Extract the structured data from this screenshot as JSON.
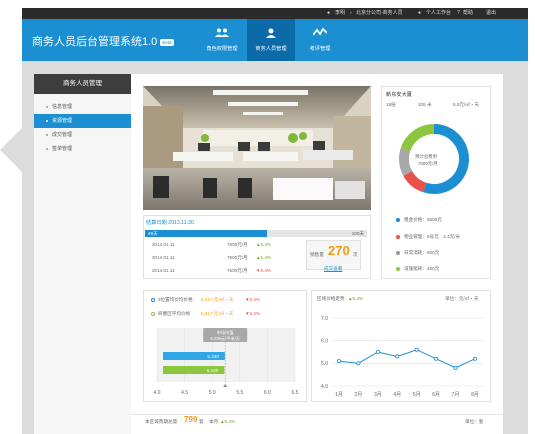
{
  "topbar": {
    "user": "李明",
    "org": "北京分公司-商务人员",
    "workbench": "个人工作台",
    "help": "帮助",
    "logout": "退出"
  },
  "header": {
    "title": "商务人员后台管理系统1.0",
    "beta": "Beta",
    "nav": [
      {
        "label": "角色权限管理",
        "icon": "users-icon"
      },
      {
        "label": "商务人员管理",
        "icon": "user-icon"
      },
      {
        "label": "考评管理",
        "icon": "chart-line-icon"
      }
    ],
    "active_nav": 1
  },
  "sidebar": {
    "title": "商务人员管理",
    "items": [
      "信息管理",
      "资源管理",
      "成交管理",
      "签单管理"
    ],
    "active_index": 1
  },
  "property": {
    "name": "新东安大厦",
    "stats": [
      "18层",
      "105 米",
      "6.5元/㎡・天"
    ],
    "donut_center_line1": "预计总费用",
    "donut_center_line2": "7000元/月",
    "fees": [
      {
        "label": "租金价格：5500元",
        "color": "#1b8fd2"
      },
      {
        "label": "物业管理：6号元　2.4元/米",
        "color": "#e8524a"
      },
      {
        "label": "日常消耗：600元",
        "color": "#999999"
      },
      {
        "label": "设施能耗：450元",
        "color": "#8cc63f"
      }
    ]
  },
  "donut_data": [
    {
      "value": 55,
      "color": "#1b8fd2"
    },
    {
      "value": 12,
      "color": "#e8524a"
    },
    {
      "value": 13,
      "color": "#a8a8a8"
    },
    {
      "value": 20,
      "color": "#8cc63f"
    }
  ],
  "countdown": {
    "title": "结算日期 2013.11.30",
    "elapsed": "49天",
    "total": "100天",
    "progress": 0.55,
    "rows": [
      {
        "date": "2014.01.11",
        "price": "7600元/月",
        "change": "▲5.4%",
        "up": true
      },
      {
        "date": "2014.01.11",
        "price": "7600元/月",
        "change": "▲5.4%",
        "up": true
      },
      {
        "date": "2014.01.11",
        "price": "7600元/月",
        "change": "▼5.4%",
        "up": false
      }
    ],
    "sold_label": "销售量",
    "sold_value": "270",
    "sold_unit": "次",
    "sold_link": "成交查看"
  },
  "compare": {
    "legend": [
      {
        "label": "3位置均价均价格",
        "value": "5.417 元/㎡・天",
        "change": "▼5.4%",
        "color": "#1b8fd2"
      },
      {
        "label": "商圈区平均价格",
        "value": "5.417 元/㎡・天",
        "change": "▼5.4%",
        "color": "#8cc63f"
      }
    ],
    "tooltip1": "市场均值",
    "tooltip2": "5.235元/平米/天",
    "bar_blue_label": "5.230",
    "bar_green_label": "5.220"
  },
  "trend": {
    "title": "区域价格走势",
    "change": "▲5.4%",
    "unit": "单位：元/㎡・天",
    "y_ticks": [
      "7.0",
      "6.0",
      "5.0",
      "4.0"
    ],
    "months": [
      "1月",
      "2月",
      "3月",
      "4月",
      "5月",
      "6月",
      "7月",
      "8月"
    ]
  },
  "chart_data": [
    {
      "type": "bar",
      "categories": [
        "3位置均价均价格",
        "商圈区平均价格"
      ],
      "values": [
        5.23,
        5.22
      ],
      "xlim": [
        4.0,
        6.5
      ],
      "x_ticks": [
        "4.0",
        "4.5",
        "5.0",
        "5.5",
        "6.0",
        "6.5"
      ],
      "reference_value": 5.235,
      "orientation": "horizontal"
    },
    {
      "type": "line",
      "title": "区域价格走势",
      "categories": [
        "1月",
        "2月",
        "3月",
        "4月",
        "5月",
        "6月",
        "7月",
        "8月"
      ],
      "values": [
        5.1,
        5.0,
        5.5,
        5.3,
        5.6,
        5.2,
        4.8,
        5.2
      ],
      "ylim": [
        4.0,
        7.0
      ]
    }
  ],
  "footer": {
    "label": "本区域周期总量",
    "value": "799",
    "value_unit": "套",
    "month_label": "本月",
    "month_change": "▲5.4%",
    "unit": "单位：套"
  }
}
